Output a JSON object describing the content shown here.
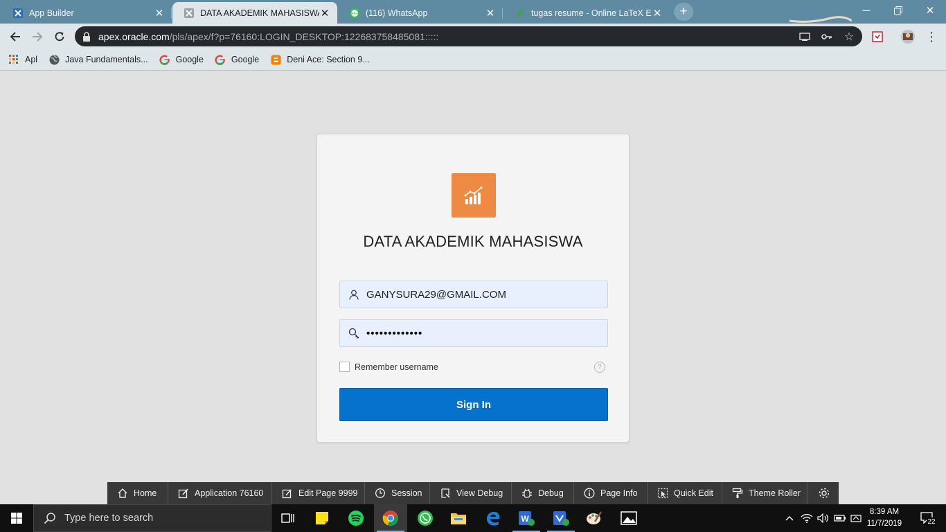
{
  "browser": {
    "tabs": [
      {
        "title": "App Builder",
        "icon": "apex-icon"
      },
      {
        "title": "DATA AKADEMIK MAHASISWA - ",
        "icon": "apex-icon"
      },
      {
        "title": "(116) WhatsApp",
        "icon": "whatsapp-icon"
      },
      {
        "title": "tugas resume - Online LaTeX Edito",
        "icon": "overleaf-icon"
      }
    ],
    "url_host": "apex.oracle.com",
    "url_path": "/pls/apex/f?p=76160:LOGIN_DESKTOP:122683758485081:::::",
    "bookmarks": [
      {
        "label": "Apl",
        "icon": "apps-grid-icon"
      },
      {
        "label": "Java Fundamentals...",
        "icon": "globe-icon"
      },
      {
        "label": "Google",
        "icon": "google-icon"
      },
      {
        "label": "Google",
        "icon": "google-icon"
      },
      {
        "label": "Deni Ace: Section 9...",
        "icon": "blogger-icon"
      }
    ]
  },
  "login": {
    "app_title": "DATA AKADEMIK MAHASISWA",
    "username": "GANYSURA29@GMAIL.COM",
    "password_masked": "•••••••••••••",
    "remember_label": "Remember username",
    "remember_checked": false,
    "help_label": "?",
    "sign_in_label": "Sign In"
  },
  "devbar": {
    "items": [
      {
        "label": "Home",
        "icon": "home-icon"
      },
      {
        "label": "Application 76160",
        "icon": "edit-app-icon"
      },
      {
        "label": "Edit Page 9999",
        "icon": "edit-page-icon"
      },
      {
        "label": "Session",
        "icon": "clock-icon"
      },
      {
        "label": "View Debug",
        "icon": "view-debug-icon"
      },
      {
        "label": "Debug",
        "icon": "bug-icon"
      },
      {
        "label": "Page Info",
        "icon": "info-icon"
      },
      {
        "label": "Quick Edit",
        "icon": "quick-edit-icon"
      },
      {
        "label": "Theme Roller",
        "icon": "paint-roller-icon"
      }
    ]
  },
  "taskbar": {
    "search_placeholder": "Type here to search",
    "time": "8:39 AM",
    "date": "11/7/2019",
    "notifications": "22"
  },
  "colors": {
    "accent": "#0572ce",
    "app_logo": "#ef8a45",
    "tabstrip": "#5e8ba1"
  }
}
